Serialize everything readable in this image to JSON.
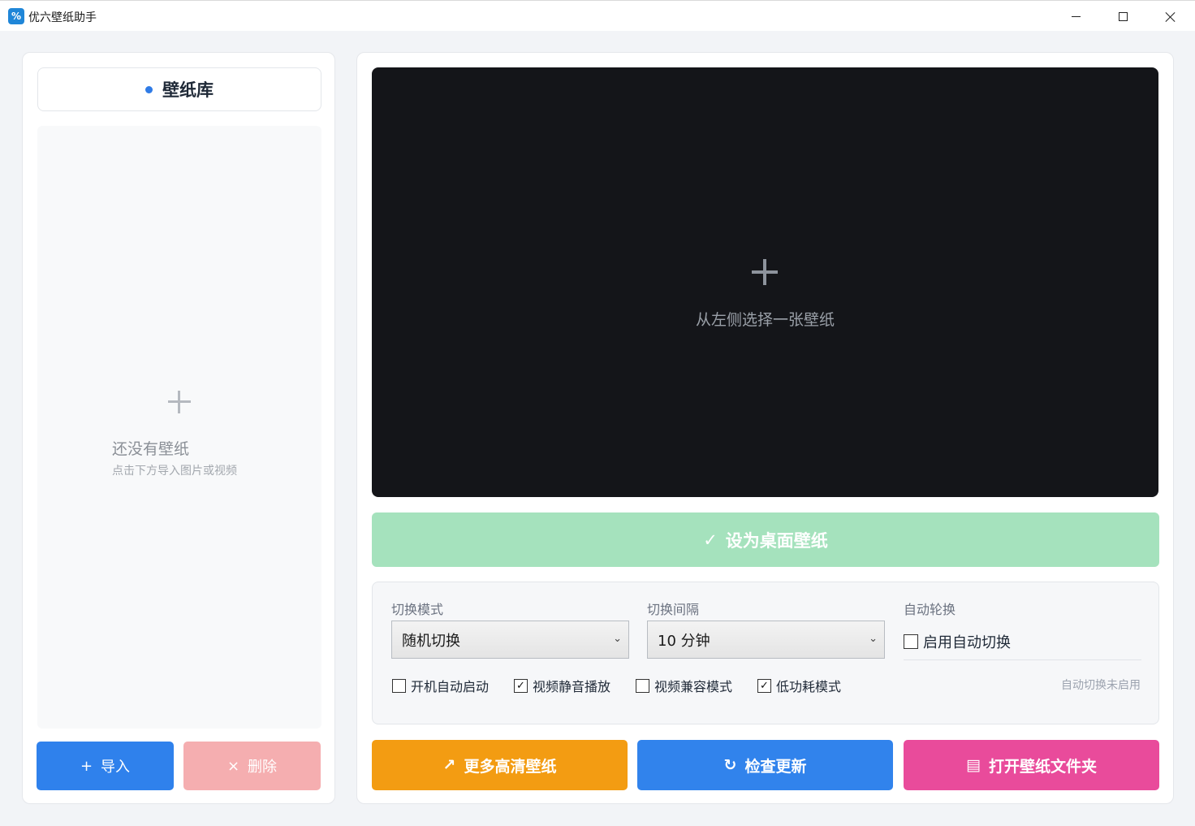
{
  "window": {
    "icon_text": "%",
    "title": "优六壁纸助手"
  },
  "library": {
    "title": "壁纸库",
    "empty_title": "还没有壁纸",
    "empty_subtitle": "点击下方导入图片或视频",
    "import_icon": "+",
    "import_label": "导入",
    "delete_icon": "×",
    "delete_label": "删除"
  },
  "preview": {
    "hint": "从左侧选择一张壁纸"
  },
  "set_wallpaper": {
    "icon": "✓",
    "label": "设为桌面壁纸"
  },
  "settings": {
    "mode_label": "切换模式",
    "mode_value": "随机切换",
    "interval_label": "切换间隔",
    "interval_value": "10 分钟",
    "auto_label": "自动轮换",
    "auto_checkbox": "启用自动切换",
    "auto_checked": false,
    "startup": {
      "label": "开机自动启动",
      "checked": false
    },
    "mute_video": {
      "label": "视频静音播放",
      "checked": true
    },
    "compat_mode": {
      "label": "视频兼容模式",
      "checked": false
    },
    "low_power": {
      "label": "低功耗模式",
      "checked": true
    },
    "status": "自动切换未启用",
    "chevron": "⌄"
  },
  "actions": {
    "more_icon": "↗",
    "more_label": "更多高清壁纸",
    "update_icon": "↻",
    "update_label": "检查更新",
    "folder_icon": "▤",
    "folder_label": "打开壁纸文件夹"
  },
  "colors": {
    "accent_blue": "#2f81ec",
    "success_disabled": "#a5e2bd",
    "orange": "#f39c12",
    "pink": "#e94b9b",
    "delete_disabled": "#f5aeb0"
  }
}
